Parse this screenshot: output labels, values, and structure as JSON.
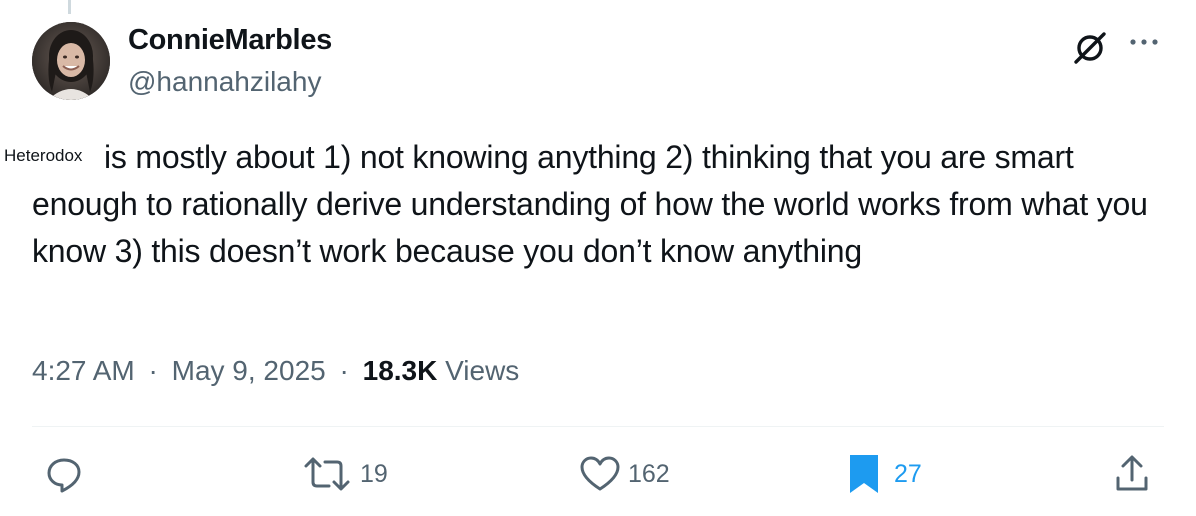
{
  "author": {
    "display_name": "ConnieMarbles",
    "handle": "@hannahzilahy",
    "avatar_icon": "profile-photo"
  },
  "overlay_label": "Heterodox",
  "tweet": {
    "text": "is mostly about 1) not knowing anything 2) thinking that you are smart enough to rationally derive understanding of how the world works from what you know 3) this doesn’t work because you don’t know anything"
  },
  "meta": {
    "time": "4:27 AM",
    "separator": "·",
    "date": "May 9, 2025",
    "views_count": "18.3K",
    "views_label": "Views"
  },
  "actions": {
    "reply": {
      "icon": "reply-icon",
      "count": ""
    },
    "retweet": {
      "icon": "retweet-icon",
      "count": "19"
    },
    "like": {
      "icon": "heart-icon",
      "count": "162"
    },
    "bookmark": {
      "icon": "bookmark-icon",
      "count": "27",
      "active": true
    },
    "share": {
      "icon": "share-icon",
      "count": ""
    }
  },
  "colors": {
    "text_primary": "#0f1419",
    "text_secondary": "#536471",
    "accent_blue": "#1d9bf0",
    "divider": "#eff3f4"
  }
}
